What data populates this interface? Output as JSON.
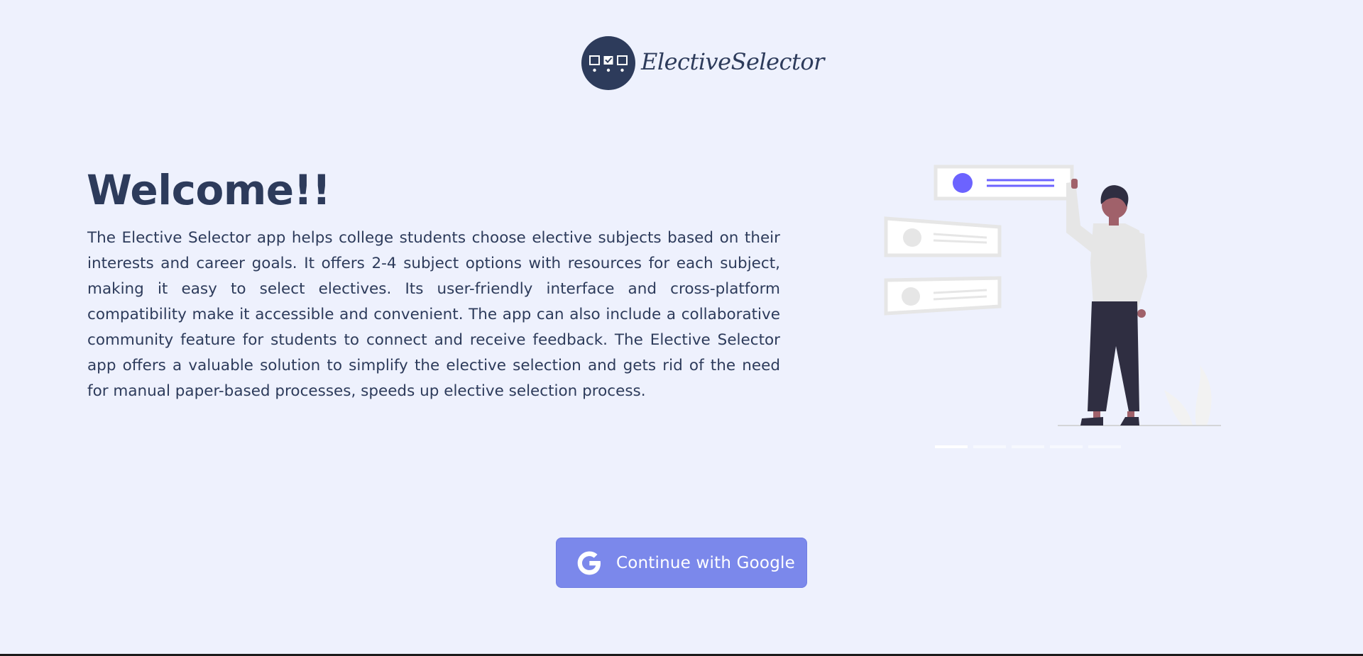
{
  "brand": {
    "name": "ElectiveSelector",
    "logo_icon": "checkbox-ballot-icon",
    "logo_bg_color": "#2d3b5b"
  },
  "welcome": {
    "title": "Welcome!!",
    "description": "The Elective Selector app helps college students choose elective subjects based on their interests and career goals. It offers 2-4 subject options with resources for each subject, making it easy to select electives. Its user-friendly interface and cross-platform compatibility make it accessible and convenient. The app can also include a collaborative community feature for students to connect and receive feedback. The Elective Selector app offers a valuable solution to simplify the elective selection and gets rid of the need for manual paper-based processes, speeds up elective selection process."
  },
  "illustration": {
    "name": "person-selecting-options-illustration",
    "accent_color": "#6c63ff"
  },
  "carousel": {
    "slide_count": 5,
    "active_index": 0
  },
  "login": {
    "button_label": "Continue with Google",
    "icon": "google-icon",
    "button_color": "#7b88eb"
  },
  "colors": {
    "background": "#eef1fd",
    "text": "#2d3b5b"
  }
}
